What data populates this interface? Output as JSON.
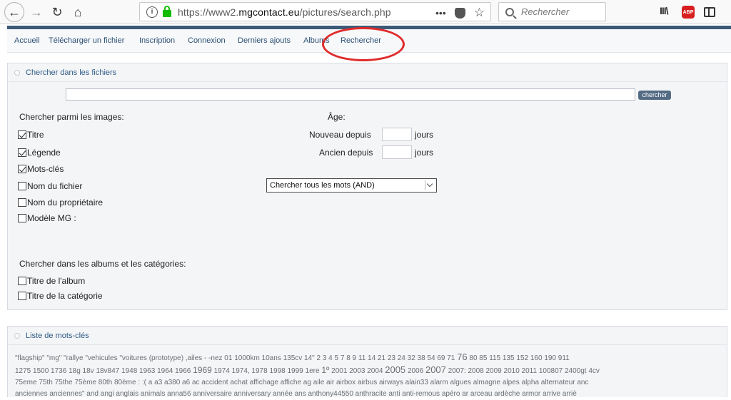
{
  "browser": {
    "url_prefix": "https://www2.",
    "url_domain": "mgcontact.eu",
    "url_path": "/pictures/search.php",
    "search_placeholder": "Rechercher",
    "more_label": "•••",
    "star_label": "☆",
    "library_label": "III\\",
    "abp_label": "ABP"
  },
  "nav": {
    "items": [
      "Accueil",
      "Télécharger un fichier",
      "Inscription",
      "Connexion",
      "Derniers ajouts",
      "Albums",
      "Rechercher"
    ]
  },
  "search_panel": {
    "title": "Chercher dans les fichiers",
    "search_button": "chercher",
    "images_heading": "Chercher parmi les images:",
    "image_fields": [
      {
        "label": "Titre",
        "checked": true
      },
      {
        "label": "Légende",
        "checked": true
      },
      {
        "label": "Mots-clés",
        "checked": true
      },
      {
        "label": "Nom du fichier",
        "checked": false
      },
      {
        "label": "Nom du propriétaire",
        "checked": false
      },
      {
        "label": "Modèle MG :",
        "checked": false
      }
    ],
    "age_heading": "Âge:",
    "newer_label": "Nouveau depuis",
    "older_label": "Ancien depuis",
    "days_label": "jours",
    "mode_selected": "Chercher tous les mots (AND)",
    "albums_heading": "Chercher dans les albums et les catégories:",
    "album_fields": [
      {
        "label": "Titre de l'album",
        "checked": false
      },
      {
        "label": "Titre de la catégorie",
        "checked": false
      }
    ]
  },
  "keywords_panel": {
    "title": "Liste de mots-clés",
    "line1": "\"flagship\" \"mg\" \"rallye \"vehicules \"voitures (prototype) ,ailes - -nez 01 1000km 10ans 135cv 14\" 2 3 4 5 7 8 9 11 14 21 23 24 32 38 54 69 71",
    "line1_big": "76",
    "line1_end": "80 85 115 135 152 160 190 911",
    "line2_a": "1275 1500 1736 18g 18v 18v847 1948 1963 1964 1966",
    "line2_b": "1969",
    "line2_c": "1974 1974, 1978 1998 1999 1ere",
    "line2_d": "1º",
    "line2_e": "2001 2003 2004",
    "line2_f": "2005",
    "line2_g": "2006",
    "line2_h": "2007",
    "line2_i": "2007: 2008 2009 2010 2011 100807 2400gt 4cv",
    "line3": "75eme 75th 75the 75ème 80th 80ème : :( a a3 a380 a6 ac accident achat affichage affiche ag aile air airbox airbus airways alain33 alarm algues almagne alpes alpha alternateur anc",
    "line4": "anciennes anciennes\" and angi anglais animals anna56 anniversaire anniversary année ans anthony44550 anthracite anti anti-remous apéro ar arceau ardèche armor arrive arriè"
  }
}
